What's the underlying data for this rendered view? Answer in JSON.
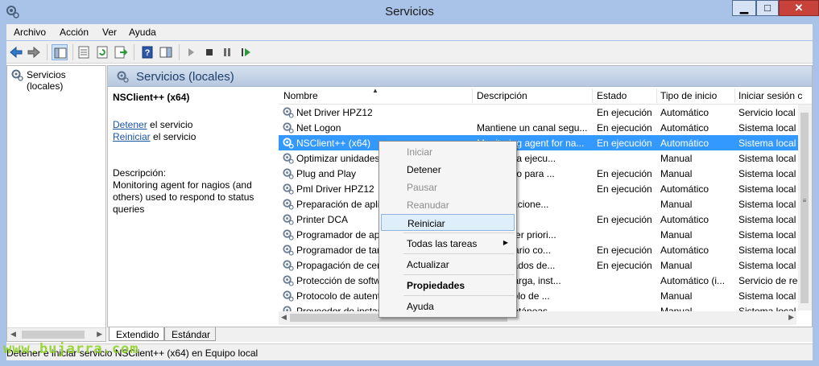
{
  "window": {
    "title": "Servicios"
  },
  "menu": [
    "Archivo",
    "Acción",
    "Ver",
    "Ayuda"
  ],
  "tree": {
    "item": "Servicios (locales)"
  },
  "header": {
    "title": "Servicios (locales)"
  },
  "details": {
    "service_name": "NSClient++ (x64)",
    "stop_link": "Detener",
    "stop_suffix": " el servicio",
    "restart_link": "Reiniciar",
    "restart_suffix": " el servicio",
    "description_label": "Descripción:",
    "description": "Monitoring agent for nagios (and others) used to respond to status queries"
  },
  "columns": [
    "Nombre",
    "Descripción",
    "Estado",
    "Tipo de inicio",
    "Iniciar sesión c"
  ],
  "rows": [
    {
      "name": "Net Driver HPZ12",
      "desc": "",
      "state": "En ejecución",
      "start": "Automático",
      "login": "Servicio local"
    },
    {
      "name": "Net Logon",
      "desc": "Mantiene un canal segu...",
      "state": "En ejecución",
      "start": "Automático",
      "login": "Sistema local"
    },
    {
      "name": "NSClient++ (x64)",
      "desc": "Monitoring agent for na...",
      "state": "En ejecución",
      "start": "Automático",
      "login": "Sistema local"
    },
    {
      "name": "Optimizar unidades",
      "desc": "...equipo a ejecu...",
      "state": "",
      "start": "Manual",
      "login": "Sistema local"
    },
    {
      "name": "Plug and Play",
      "desc": "...n equipo para ...",
      "state": "En ejecución",
      "start": "Manual",
      "login": "Sistema local"
    },
    {
      "name": "Pml Driver HPZ12",
      "desc": "",
      "state": "En ejecución",
      "start": "Automático",
      "login": "Sistema local"
    },
    {
      "name": "Preparación de apli",
      "desc": "...s aplicacione...",
      "state": "",
      "start": "Manual",
      "login": "Sistema local"
    },
    {
      "name": "Printer DCA",
      "desc": "",
      "state": "En ejecución",
      "start": "Automático",
      "login": "Sistema local"
    },
    {
      "name": "Programador de ap",
      "desc": "...stablecer priori...",
      "state": "",
      "start": "Manual",
      "login": "Sistema local"
    },
    {
      "name": "Programador de tar",
      "desc": "...un usuario co...",
      "state": "En ejecución",
      "start": "Automático",
      "login": "Sistema local"
    },
    {
      "name": "Propagación de cer",
      "desc": "...certificados de...",
      "state": "En ejecución",
      "start": "Manual",
      "login": "Sistema local"
    },
    {
      "name": "Protección de softw",
      "desc": "...a descarga, inst...",
      "state": "",
      "start": "Automático (i...",
      "login": "Servicio de red"
    },
    {
      "name": "Protocolo de autent",
      "desc": "...Protocolo de ...",
      "state": "",
      "start": "Manual",
      "login": "Sistema local"
    },
    {
      "name": "Proveedor de instan",
      "desc": "...a instantáneas...",
      "state": "",
      "start": "Manual",
      "login": "Sistema local"
    }
  ],
  "selected_row": 2,
  "context_menu": {
    "items": [
      {
        "label": "Iniciar",
        "enabled": false
      },
      {
        "label": "Detener",
        "enabled": true
      },
      {
        "label": "Pausar",
        "enabled": false
      },
      {
        "label": "Reanudar",
        "enabled": false
      },
      {
        "label": "Reiniciar",
        "enabled": true,
        "hover": true
      },
      {
        "label": "Todas las tareas",
        "enabled": true,
        "submenu": true
      },
      {
        "label": "Actualizar",
        "enabled": true
      },
      {
        "label": "Propiedades",
        "enabled": true,
        "bold": true
      },
      {
        "label": "Ayuda",
        "enabled": true
      }
    ]
  },
  "tabs": [
    "Extendido",
    "Estándar"
  ],
  "active_tab": "Extendido",
  "status": {
    "text": "Detener e iniciar servicio NSClient++ (x64) en Equipo local"
  },
  "watermark": "www.bujarra.com",
  "colors": {
    "accent": "#a9c3e8",
    "selection": "#3399ff",
    "link": "#1a55a5"
  }
}
